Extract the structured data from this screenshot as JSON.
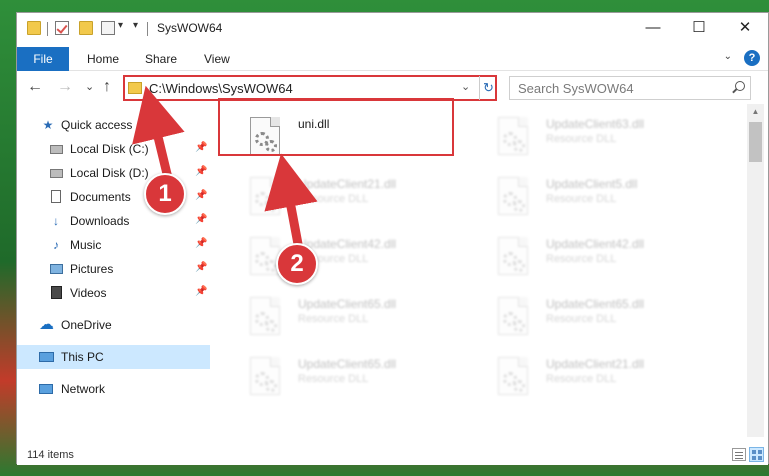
{
  "window": {
    "title": "SysWOW64",
    "minimize_glyph": "—",
    "maximize_glyph": "☐",
    "close_glyph": "✕"
  },
  "ribbon": {
    "tabs": [
      "File",
      "Home",
      "Share",
      "View"
    ]
  },
  "address": {
    "path": "C:\\Windows\\SysWOW64",
    "dropdown_glyph": "⌄",
    "refresh_glyph": "↻"
  },
  "search": {
    "placeholder": "Search SysWOW64"
  },
  "nav": {
    "back_glyph": "←",
    "forward_glyph": "→",
    "recent_glyph": "⌄",
    "up_glyph": "↑",
    "items": [
      {
        "label": "Quick access",
        "icon": "star-icon",
        "pinned": false
      },
      {
        "label": "Local Disk (C:)",
        "icon": "drive-icon",
        "pinned": true
      },
      {
        "label": "Local Disk (D:)",
        "icon": "drive-icon",
        "pinned": true
      },
      {
        "label": "Documents",
        "icon": "documents-icon",
        "pinned": true
      },
      {
        "label": "Downloads",
        "icon": "download-icon",
        "pinned": true
      },
      {
        "label": "Music",
        "icon": "music-icon",
        "pinned": true
      },
      {
        "label": "Pictures",
        "icon": "pictures-icon",
        "pinned": true
      },
      {
        "label": "Videos",
        "icon": "videos-icon",
        "pinned": true
      },
      {
        "label": "OneDrive",
        "icon": "cloud-icon",
        "pinned": false
      },
      {
        "label": "This PC",
        "icon": "computer-icon",
        "pinned": false,
        "selected": true
      },
      {
        "label": "Network",
        "icon": "network-icon",
        "pinned": false
      }
    ]
  },
  "files": [
    {
      "name": "uni.dll",
      "type": "",
      "highlighted": true
    },
    {
      "name": "UpdateClient63.dll",
      "type": "Resource DLL"
    },
    {
      "name": "UpdateClient21.dll",
      "type": "Resource DLL"
    },
    {
      "name": "UpdateClient5.dll",
      "type": "Resource DLL"
    },
    {
      "name": "UpdateClient42.dll",
      "type": "Resource DLL"
    },
    {
      "name": "UpdateClient42.dll",
      "type": "Resource DLL"
    },
    {
      "name": "UpdateClient65.dll",
      "type": "Resource DLL"
    },
    {
      "name": "UpdateClient65.dll",
      "type": "Resource DLL"
    },
    {
      "name": "UpdateClient65.dll",
      "type": "Resource DLL"
    },
    {
      "name": "UpdateClient21.dll",
      "type": "Resource DLL"
    }
  ],
  "status": {
    "item_count": "114 items"
  },
  "annotations": {
    "step1": "1",
    "step2": "2",
    "color": "#d9373a"
  }
}
